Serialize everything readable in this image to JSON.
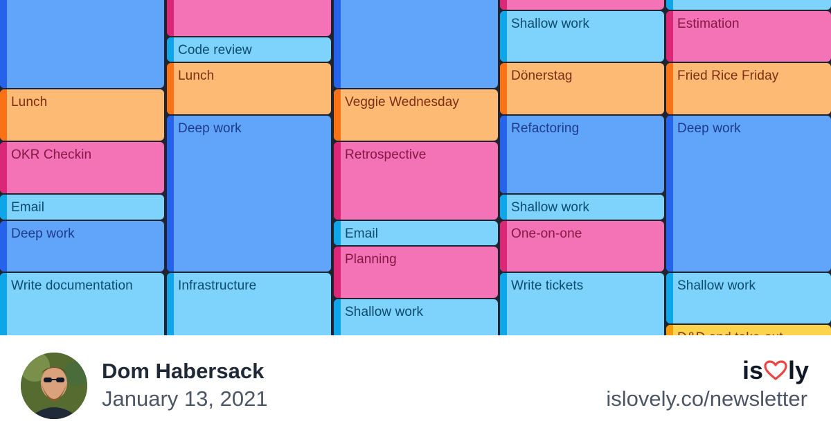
{
  "calendar": {
    "columns": [
      {
        "events": [
          {
            "label": "",
            "kind": "deep"
          },
          {
            "label": "Lunch",
            "kind": "lunch"
          },
          {
            "label": "OKR Checkin",
            "kind": "meet"
          },
          {
            "label": "Email",
            "kind": "shallow"
          },
          {
            "label": "Deep work",
            "kind": "deep"
          },
          {
            "label": "Write documentation",
            "kind": "shallow"
          }
        ]
      },
      {
        "events": [
          {
            "label": "",
            "kind": "meet"
          },
          {
            "label": "Code review",
            "kind": "shallow"
          },
          {
            "label": "Lunch",
            "kind": "lunch"
          },
          {
            "label": "Deep work",
            "kind": "deep"
          },
          {
            "label": "Infrastructure",
            "kind": "shallow"
          }
        ]
      },
      {
        "events": [
          {
            "label": "",
            "kind": "deep"
          },
          {
            "label": "Veggie Wednesday",
            "kind": "lunch"
          },
          {
            "label": "Retrospective",
            "kind": "meet"
          },
          {
            "label": "Email",
            "kind": "shallow"
          },
          {
            "label": "Planning",
            "kind": "meet"
          },
          {
            "label": "Shallow work",
            "kind": "shallow"
          }
        ]
      },
      {
        "events": [
          {
            "label": "",
            "kind": "meet"
          },
          {
            "label": "Shallow work",
            "kind": "shallow"
          },
          {
            "label": "Dönerstag",
            "kind": "lunch"
          },
          {
            "label": "Refactoring",
            "kind": "deep"
          },
          {
            "label": "Shallow work",
            "kind": "shallow"
          },
          {
            "label": "One-on-one",
            "kind": "meet"
          },
          {
            "label": "Write tickets",
            "kind": "shallow"
          }
        ]
      },
      {
        "events": [
          {
            "label": "",
            "kind": "shallow"
          },
          {
            "label": "Estimation",
            "kind": "meet"
          },
          {
            "label": "Fried Rice Friday",
            "kind": "lunch"
          },
          {
            "label": "Deep work",
            "kind": "deep"
          },
          {
            "label": "Shallow work",
            "kind": "shallow"
          },
          {
            "label": "D&D and take-out",
            "kind": "fun"
          }
        ]
      }
    ]
  },
  "footer": {
    "author": "Dom Habersack",
    "date": "January 13, 2021",
    "brand_left": "is",
    "brand_right": "ly",
    "brand_icon": "heart-icon",
    "url": "islovely.co/newsletter"
  },
  "colors": {
    "heart": "#ef4444",
    "deep": "#60a5fa",
    "shallow": "#7dd3fc",
    "lunch": "#fdba74",
    "meeting": "#f472b6",
    "social": "#fcd34d"
  }
}
